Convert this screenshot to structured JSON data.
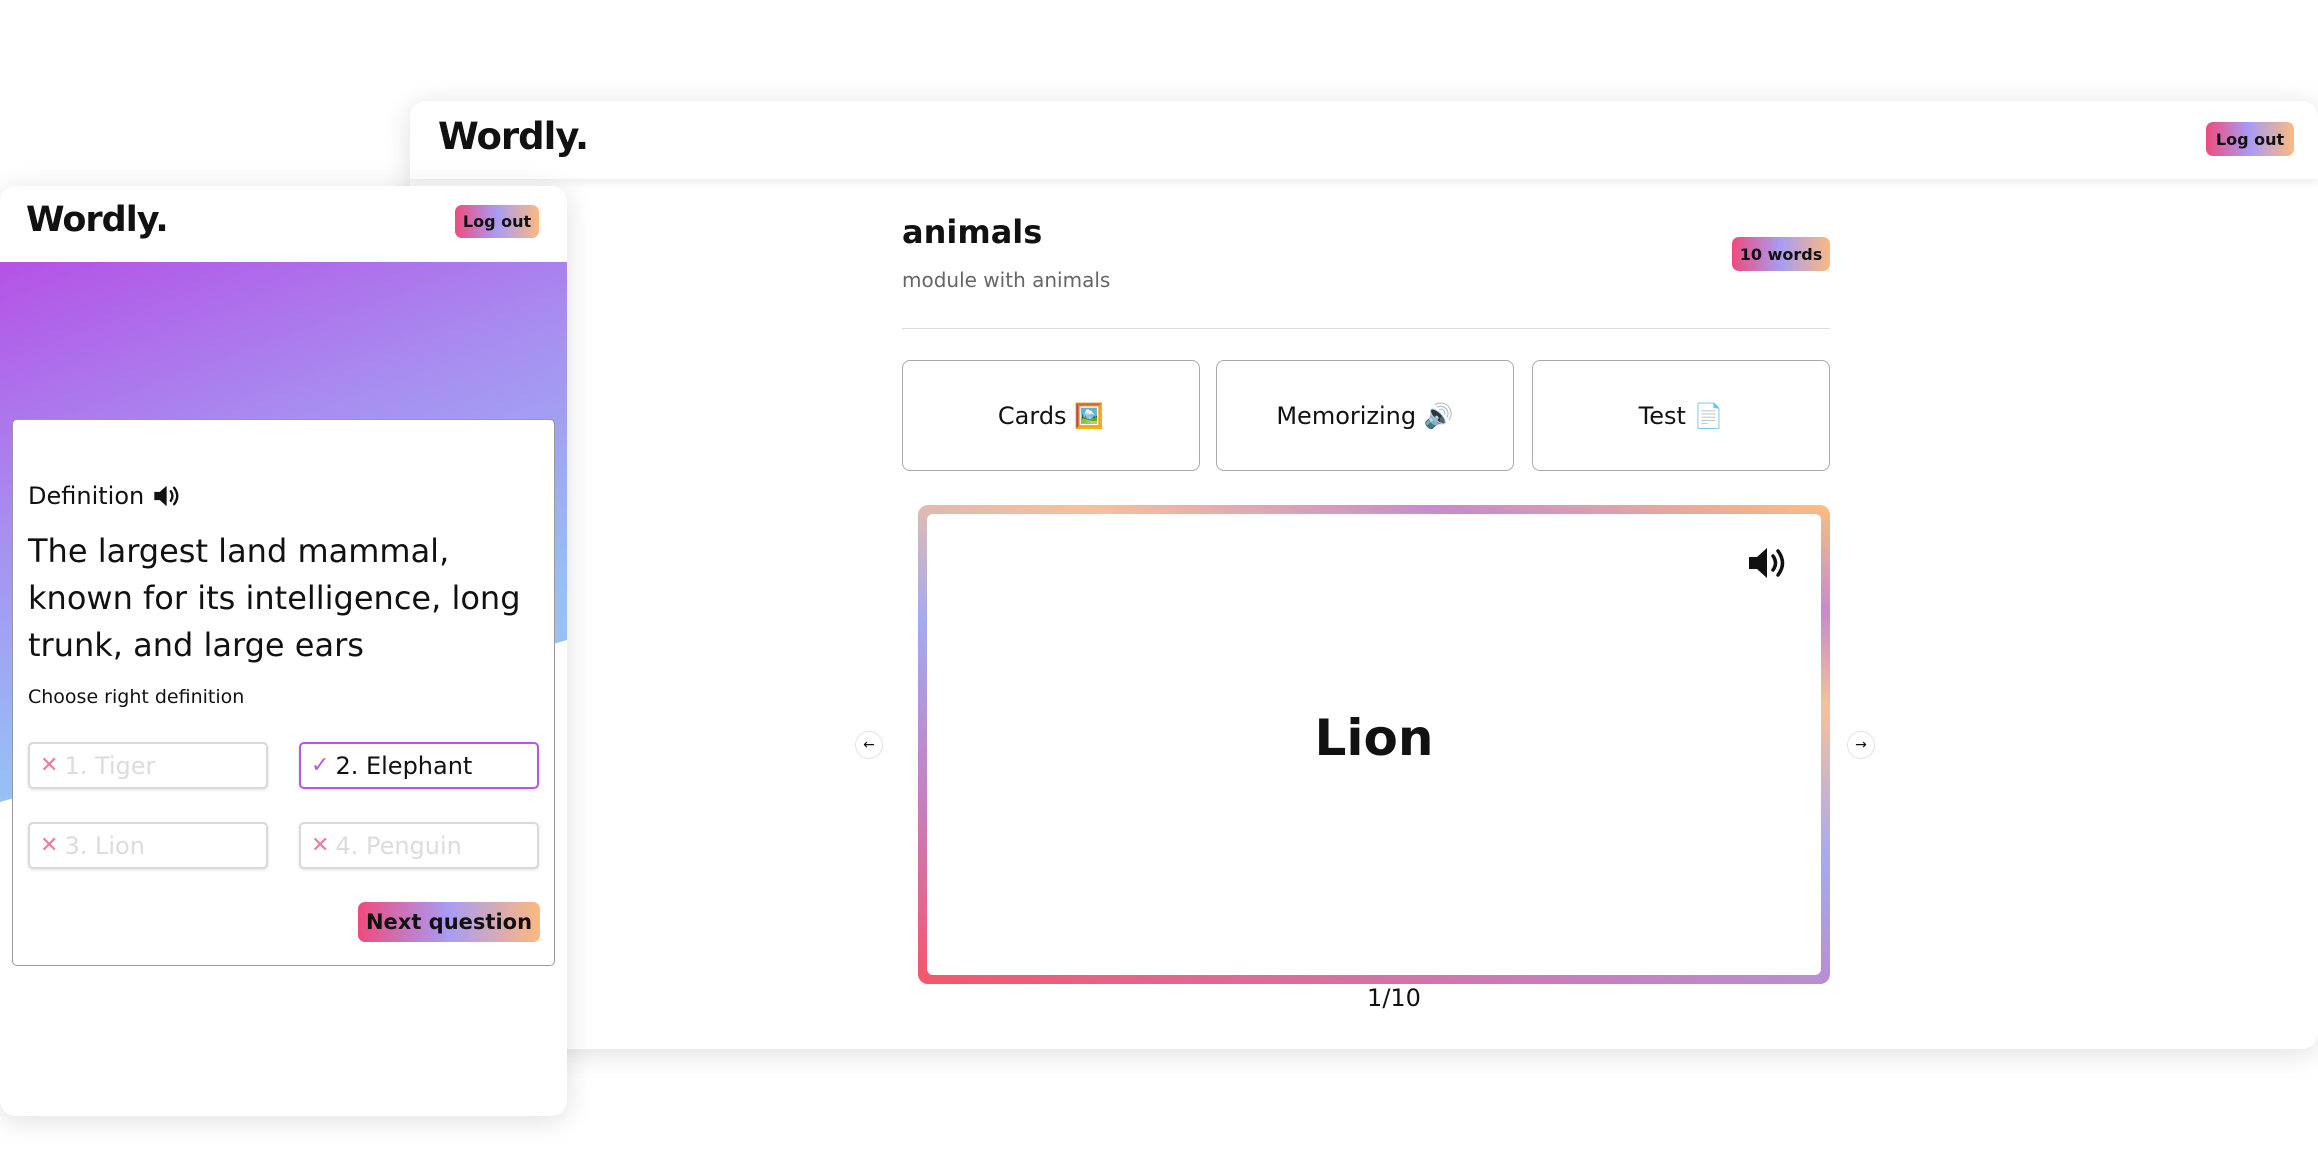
{
  "desktop": {
    "logo": "Wordly.",
    "logout_label": "Log out",
    "module": {
      "title": "animals",
      "description": "module with animals",
      "word_count": "10 words"
    },
    "modes": [
      {
        "label": "Cards 🖼️",
        "icon": "image-icon"
      },
      {
        "label": "Memorizing 🔊",
        "icon": "speaker-icon"
      },
      {
        "label": "Test 📄",
        "icon": "document-icon"
      }
    ],
    "flashcard": {
      "word": "Lion",
      "speaker_icon": "speaker-icon",
      "counter": "1/10"
    },
    "nav": {
      "prev_icon": "arrow-left-icon",
      "next_icon": "arrow-right-icon",
      "prev_glyph": "←",
      "next_glyph": "→"
    }
  },
  "mobile": {
    "logo": "Wordly.",
    "logout_label": "Log out",
    "quiz": {
      "definition_label": "Definition",
      "definition_text": "The largest land mammal, known for its intelligence, long trunk, and large ears",
      "prompt": "Choose right definition",
      "options": [
        {
          "label": "1. Tiger",
          "state": "wrong",
          "mark": "✕"
        },
        {
          "label": "2. Elephant",
          "state": "correct",
          "mark": "✓"
        },
        {
          "label": "3. Lion",
          "state": "wrong",
          "mark": "✕"
        },
        {
          "label": "4. Penguin",
          "state": "wrong",
          "mark": "✕"
        }
      ],
      "next_label": "Next question"
    }
  },
  "colors": {
    "gradient": [
      "#ef4b7e",
      "#a89cf4",
      "#fcb97f"
    ],
    "correct_border": "#b35be0",
    "wrong_mark": "#f07aa5"
  }
}
